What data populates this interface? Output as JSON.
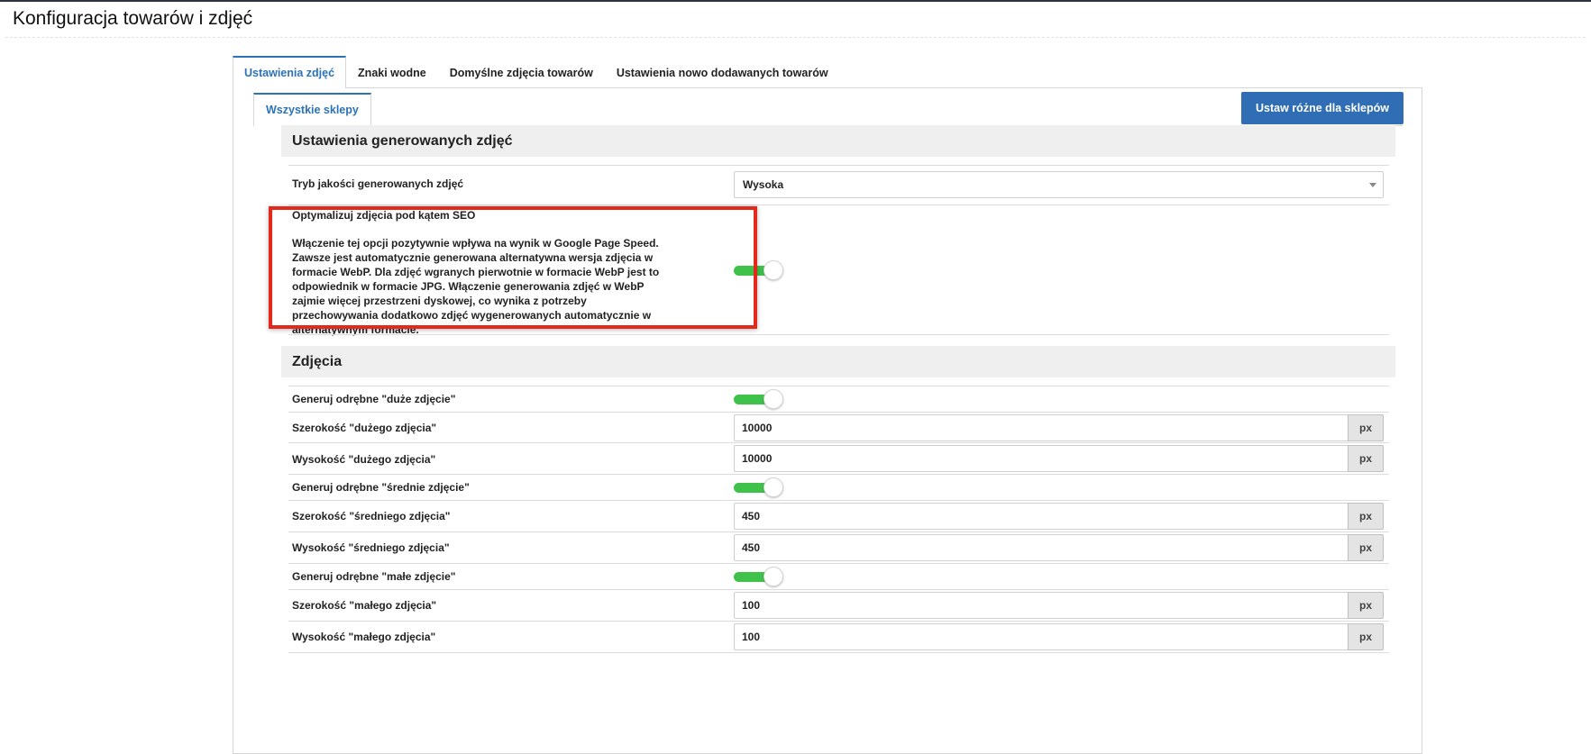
{
  "page": {
    "title": "Konfiguracja towarów i zdjęć"
  },
  "tabs": [
    {
      "label": "Ustawienia zdjęć"
    },
    {
      "label": "Znaki wodne"
    },
    {
      "label": "Domyślne zdjęcia towarów"
    },
    {
      "label": "Ustawienia nowo dodawanych towarów"
    }
  ],
  "stores": {
    "tab_label": "Wszystkie sklepy",
    "button_label": "Ustaw różne dla sklepów"
  },
  "generated": {
    "header": "Ustawienia generowanych zdjęć",
    "quality_label": "Tryb jakości generowanych zdjęć",
    "quality_value": "Wysoka",
    "seo_label": "Optymalizuj zdjęcia pod kątem SEO",
    "seo_description": "Włączenie tej opcji pozytywnie wpływa na wynik w Google Page Speed. Zawsze jest automatycznie generowana alternatywna wersja zdjęcia w formacie WebP. Dla zdjęć wgranych pierwotnie w formacie WebP jest to odpowiednik w formacie JPG. Włączenie generowania zdjęć w WebP zajmie więcej przestrzeni dyskowej, co wynika z potrzeby przechowywania dodatkowo zdjęć wygenerowanych automatycznie w alternatywnym formacie.",
    "seo_enabled": true
  },
  "photos": {
    "header": "Zdjęcia",
    "unit": "px",
    "large_toggle_label": "Generuj odrębne \"duże zdjęcie\"",
    "large_enabled": true,
    "large_width_label": "Szerokość \"dużego zdjęcia\"",
    "large_width": "10000",
    "large_height_label": "Wysokość \"dużego zdjęcia\"",
    "large_height": "10000",
    "medium_toggle_label": "Generuj odrębne \"średnie zdjęcie\"",
    "medium_enabled": true,
    "medium_width_label": "Szerokość \"średniego zdjęcia\"",
    "medium_width": "450",
    "medium_height_label": "Wysokość \"średniego zdjęcia\"",
    "medium_height": "450",
    "small_toggle_label": "Generuj odrębne \"małe zdjęcie\"",
    "small_enabled": true,
    "small_width_label": "Szerokość \"małego zdjęcia\"",
    "small_width": "100",
    "small_height_label": "Wysokość \"małego zdjęcia\"",
    "small_height": "100"
  },
  "colors": {
    "accent": "#2b72b8",
    "primary_button": "#2f6eb5",
    "toggle_on": "#3ec24a",
    "highlight": "#e3281c"
  }
}
